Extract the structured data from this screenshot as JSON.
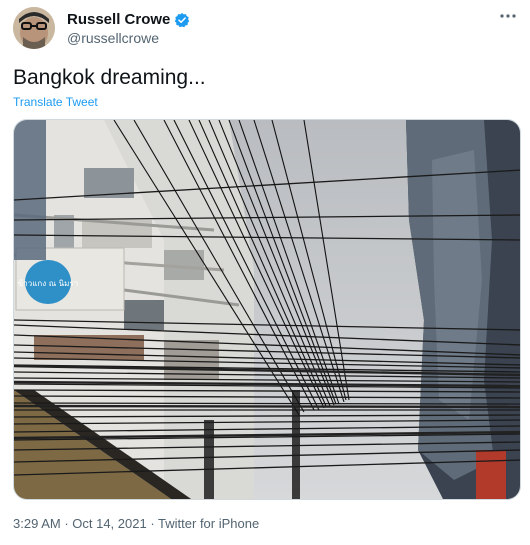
{
  "author": {
    "display_name": "Russell Crowe",
    "handle": "@russellcrowe",
    "verified": true
  },
  "tweet": {
    "text": "Bangkok dreaming...",
    "translate_label": "Translate Tweet",
    "media": {
      "kind": "photo",
      "sign_text": "ข้าวแกง ณ นิมรา"
    }
  },
  "meta": {
    "time": "3:29 AM",
    "date": "Oct 14, 2021",
    "source": "Twitter for iPhone",
    "separator": " · "
  },
  "icons": {
    "verified": "verified-badge-icon",
    "more": "more-options-icon"
  },
  "colors": {
    "accent": "#1d9bf0",
    "secondary_text": "#536471",
    "primary_text": "#0f1419"
  }
}
